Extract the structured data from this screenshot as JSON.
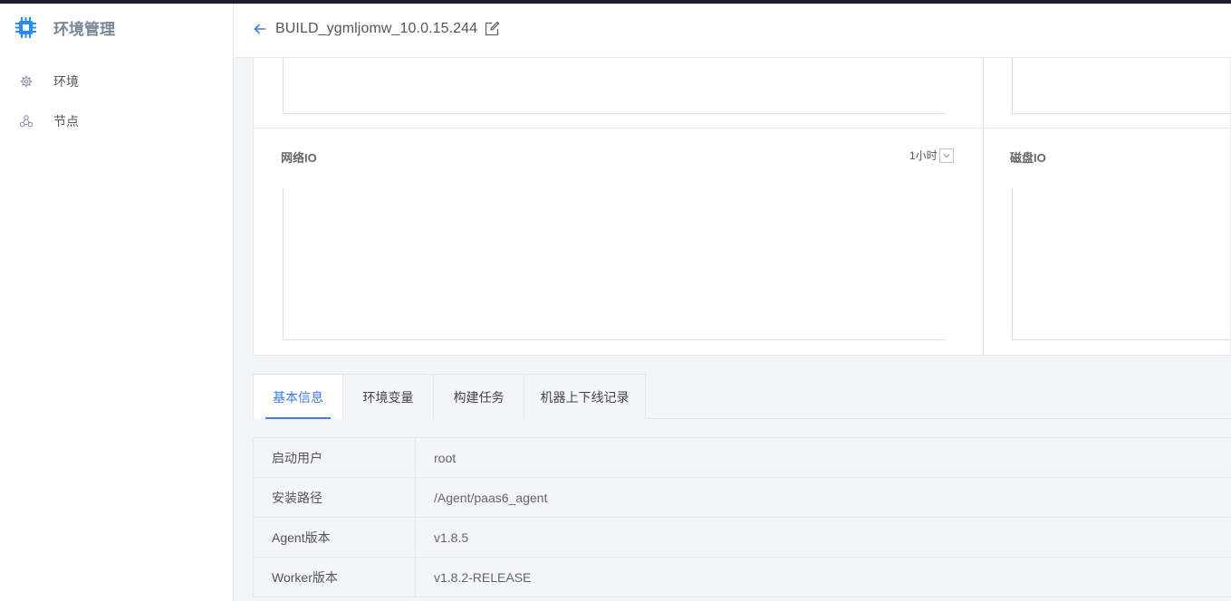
{
  "app": {
    "brand_title": "环境管理",
    "brand_icon": "chip-icon",
    "accent_color": "#3c7be8"
  },
  "sidebar": {
    "items": [
      {
        "label": "环境",
        "icon": "gear-icon"
      },
      {
        "label": "节点",
        "icon": "nodes-icon"
      }
    ]
  },
  "header": {
    "title": "BUILD_ygmljomw_10.0.15.244"
  },
  "panels": {
    "network_io": {
      "title": "网络IO",
      "time_range": "1小时"
    },
    "disk_io": {
      "title": "磁盘IO"
    }
  },
  "tabs": [
    {
      "label": "基本信息",
      "active": true
    },
    {
      "label": "环境变量",
      "active": false
    },
    {
      "label": "构建任务",
      "active": false
    },
    {
      "label": "机器上下线记录",
      "active": false
    }
  ],
  "info": [
    {
      "key": "启动用户",
      "value": "root"
    },
    {
      "key": "安装路径",
      "value": "/Agent/paas6_agent"
    },
    {
      "key": "Agent版本",
      "value": "v1.8.5"
    },
    {
      "key": "Worker版本",
      "value": "v1.8.2-RELEASE"
    }
  ]
}
